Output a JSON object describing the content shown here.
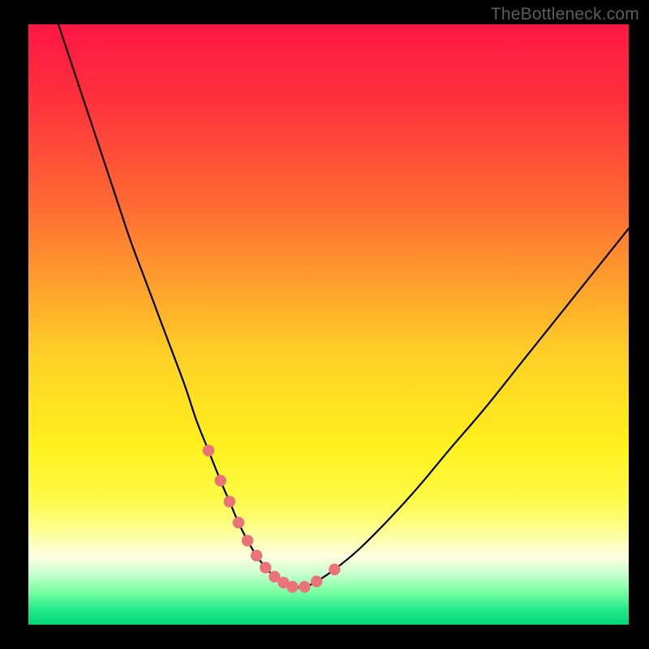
{
  "watermark": "TheBottleneck.com",
  "colors": {
    "background": "#000000",
    "watermark": "#5d5d5d",
    "curve": "#000000",
    "dots": "#ea7279",
    "gradient_stops": [
      {
        "offset": 0.0,
        "color": "#ff1744"
      },
      {
        "offset": 0.12,
        "color": "#ff2f3d"
      },
      {
        "offset": 0.3,
        "color": "#ff6a33"
      },
      {
        "offset": 0.55,
        "color": "#ffd027"
      },
      {
        "offset": 0.7,
        "color": "#fff01d"
      },
      {
        "offset": 0.79,
        "color": "#fffa46"
      },
      {
        "offset": 0.84,
        "color": "#fdff8c"
      },
      {
        "offset": 0.885,
        "color": "#ffffe0"
      },
      {
        "offset": 0.915,
        "color": "#c9ffcf"
      },
      {
        "offset": 0.945,
        "color": "#7affa0"
      },
      {
        "offset": 0.975,
        "color": "#22e98a"
      },
      {
        "offset": 1.0,
        "color": "#03d67a"
      }
    ]
  },
  "chart_data": {
    "type": "line",
    "title": "",
    "xlabel": "",
    "ylabel": "",
    "xlim": [
      0,
      100
    ],
    "ylim": [
      0,
      100
    ],
    "series": [
      {
        "name": "bottleneck-curve",
        "x": [
          5,
          8,
          11,
          14,
          17,
          20,
          23,
          26,
          28,
          30,
          32,
          33.5,
          35,
          36.5,
          38,
          39.5,
          41,
          42.5,
          44,
          46,
          48,
          51,
          55,
          60,
          65,
          70,
          76,
          82,
          88,
          94,
          100
        ],
        "y": [
          100,
          91,
          82,
          73,
          64,
          56,
          48,
          40,
          34,
          29,
          24,
          20.5,
          17,
          14,
          11.5,
          9.5,
          8,
          7,
          6.3,
          6.3,
          7.2,
          9.2,
          12.5,
          17.5,
          23,
          29,
          36,
          43.5,
          51,
          58.5,
          66
        ]
      }
    ],
    "markers": {
      "name": "highlight-dots",
      "x": [
        30,
        32,
        33.5,
        35,
        36.5,
        38,
        39.5,
        41,
        42.5,
        44,
        46,
        48,
        51
      ],
      "y": [
        29,
        24,
        20.5,
        17,
        14,
        11.5,
        9.5,
        8,
        7,
        6.3,
        6.3,
        7.2,
        9.2
      ]
    }
  }
}
